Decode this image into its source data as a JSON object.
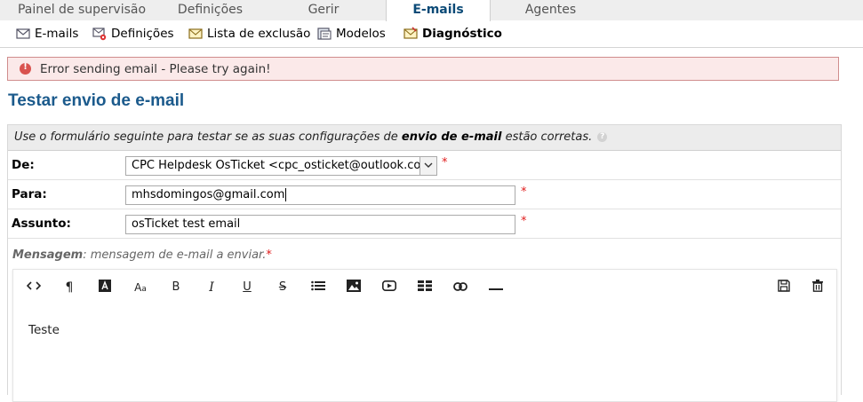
{
  "top_tabs": [
    {
      "label": "Painel de supervisão",
      "active": false
    },
    {
      "label": "Definições",
      "active": false
    },
    {
      "label": "Gerir",
      "active": false
    },
    {
      "label": "E-mails",
      "active": true
    },
    {
      "label": "Agentes",
      "active": false
    }
  ],
  "sub_tabs": [
    {
      "label": "E-mails",
      "icon": "envelope-icon"
    },
    {
      "label": "Definições",
      "icon": "email-settings-icon"
    },
    {
      "label": "Lista de exclusão",
      "icon": "banlist-icon"
    },
    {
      "label": "Modelos",
      "icon": "templates-icon"
    },
    {
      "label": "Diagnóstico",
      "icon": "diagnostic-icon",
      "active": true
    }
  ],
  "alert": {
    "message": "Error sending email - Please try again!",
    "icon": "error-icon",
    "color": "#d9534f"
  },
  "page_title": "Testar envio de e-mail",
  "intro": {
    "prefix": "Use o formulário seguinte para testar se as suas configurações de ",
    "bold": "envio de e-mail",
    "suffix": " estão corretas."
  },
  "form": {
    "from": {
      "label": "De:",
      "value": "CPC Helpdesk OsTicket <cpc_osticket@outlook.com> (SMTP)"
    },
    "to": {
      "label": "Para:",
      "value": "mhsdomingos@gmail.com"
    },
    "subject": {
      "label": "Assunto:",
      "value": "osTicket test email"
    },
    "required_mark": "*",
    "message_label": {
      "bold": "Mensagem",
      "text": ": mensagem de e-mail a enviar."
    }
  },
  "editor": {
    "content": "Teste",
    "toolbar": [
      "code-view-icon",
      "paragraph-icon",
      "text-color-icon",
      "font-size-icon",
      "bold-icon",
      "italic-icon",
      "underline-icon",
      "strikethrough-icon",
      "list-icon",
      "image-icon",
      "video-icon",
      "table-icon",
      "link-icon",
      "horizontal-rule-icon",
      "save-icon",
      "trash-icon"
    ]
  },
  "colors": {
    "accent": "#1b5a8c",
    "alert_bg": "#fbe9e9",
    "alert_border": "#d08d8d",
    "required": "#e01b1b"
  }
}
